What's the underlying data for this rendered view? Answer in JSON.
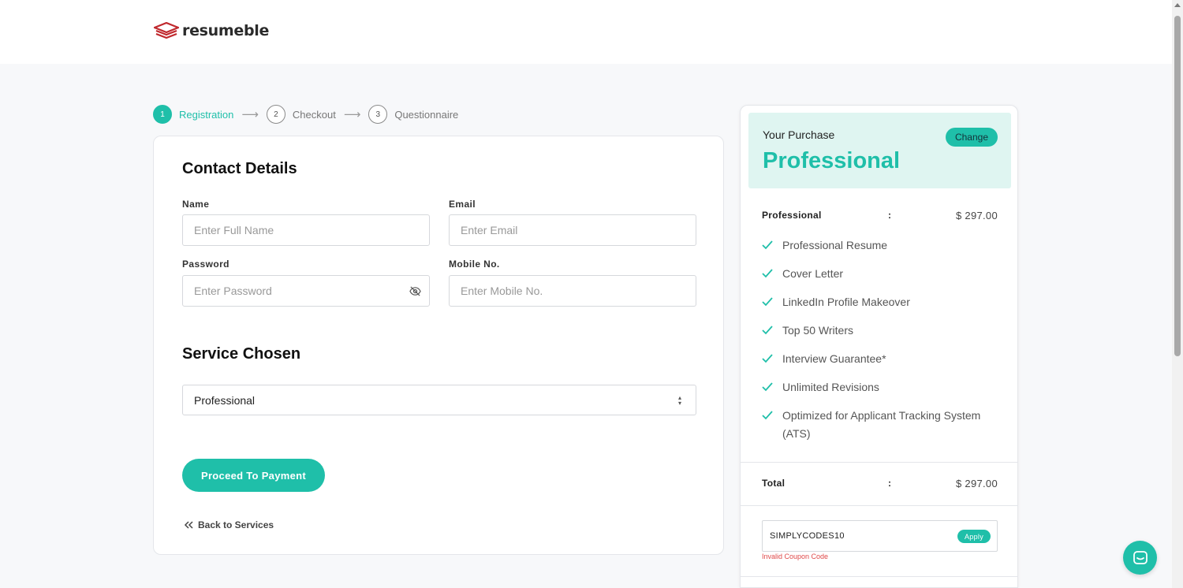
{
  "brand": {
    "name": "resumeble",
    "color": "#c0282d",
    "accent": "#1fbfa9"
  },
  "stepper": {
    "steps": [
      {
        "num": "1",
        "label": "Registration",
        "active": true
      },
      {
        "num": "2",
        "label": "Checkout",
        "active": false
      },
      {
        "num": "3",
        "label": "Questionnaire",
        "active": false
      }
    ]
  },
  "form": {
    "contact_title": "Contact Details",
    "name": {
      "label": "Name",
      "placeholder": "Enter Full Name"
    },
    "email": {
      "label": "Email",
      "placeholder": "Enter Email"
    },
    "password": {
      "label": "Password",
      "placeholder": "Enter Password"
    },
    "mobile": {
      "label": "Mobile No.",
      "placeholder": "Enter Mobile No."
    },
    "service_title": "Service Chosen",
    "service_value": "Professional",
    "proceed_label": "Proceed To Payment",
    "back_label": "Back to Services"
  },
  "summary": {
    "your_purchase": "Your Purchase",
    "plan": "Professional",
    "change_label": "Change",
    "line_item": {
      "name": "Professional",
      "colon": ":",
      "price": "$ 297.00"
    },
    "features": [
      "Professional Resume",
      "Cover Letter",
      "LinkedIn Profile Makeover",
      "Top 50 Writers",
      "Interview Guarantee*",
      "Unlimited Revisions",
      "Optimized for Applicant Tracking System (ATS)"
    ],
    "total": {
      "label": "Total",
      "colon": ":",
      "price": "$ 297.00"
    },
    "coupon_value": "SIMPLYCODES10",
    "apply_label": "Apply",
    "coupon_error": "Invalid Coupon Code"
  }
}
